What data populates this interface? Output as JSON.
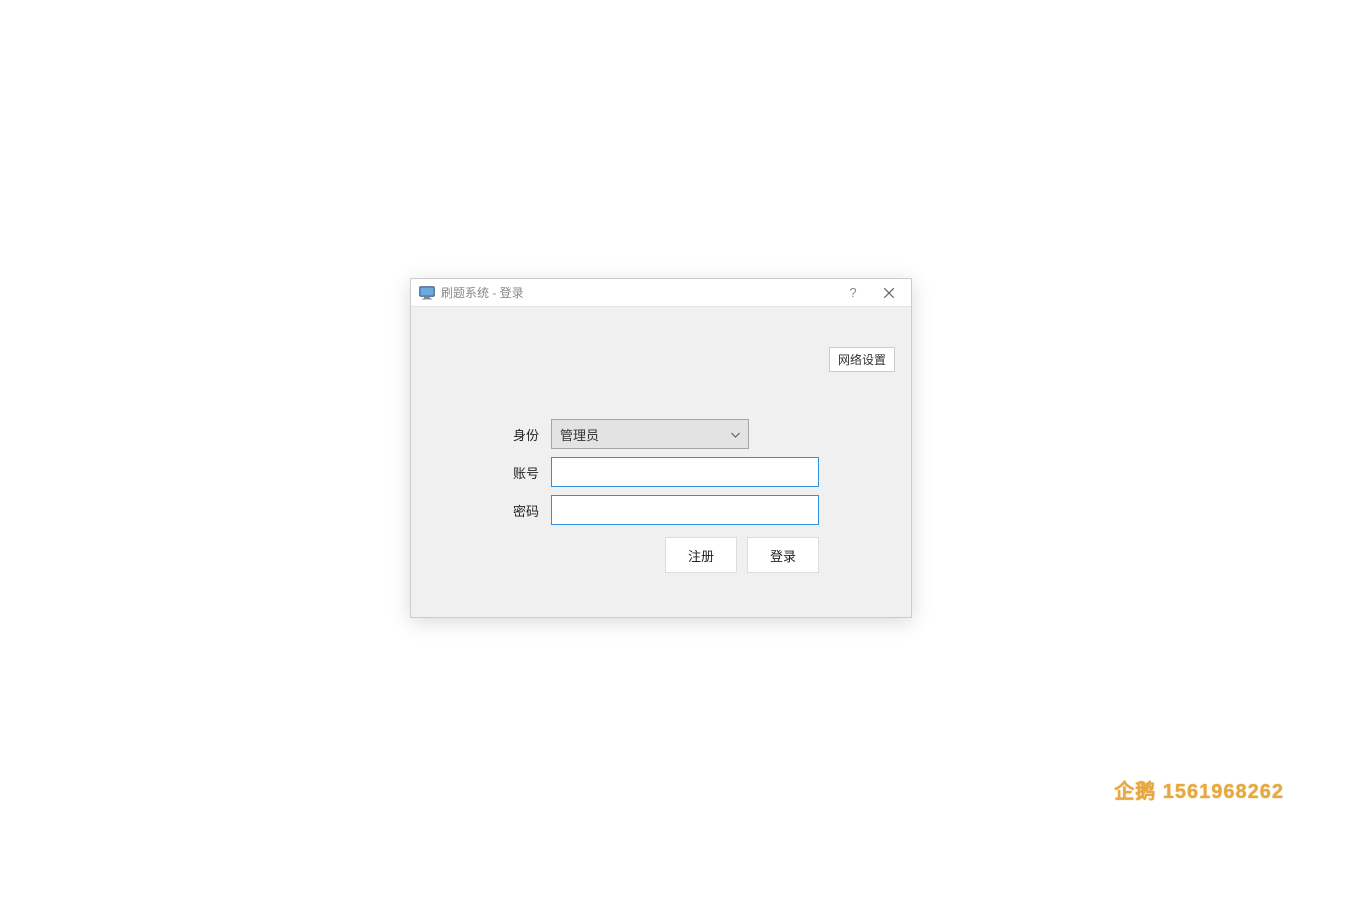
{
  "window": {
    "title": "刷题系统 - 登录",
    "help_icon": "?",
    "close_icon": "close-icon"
  },
  "toolbar": {
    "network_settings": "网络设置"
  },
  "form": {
    "role_label": "身份",
    "role_value": "管理员",
    "account_label": "账号",
    "account_value": "",
    "password_label": "密码",
    "password_value": ""
  },
  "buttons": {
    "register": "注册",
    "login": "登录"
  },
  "watermark": "企鹅 1561968262"
}
